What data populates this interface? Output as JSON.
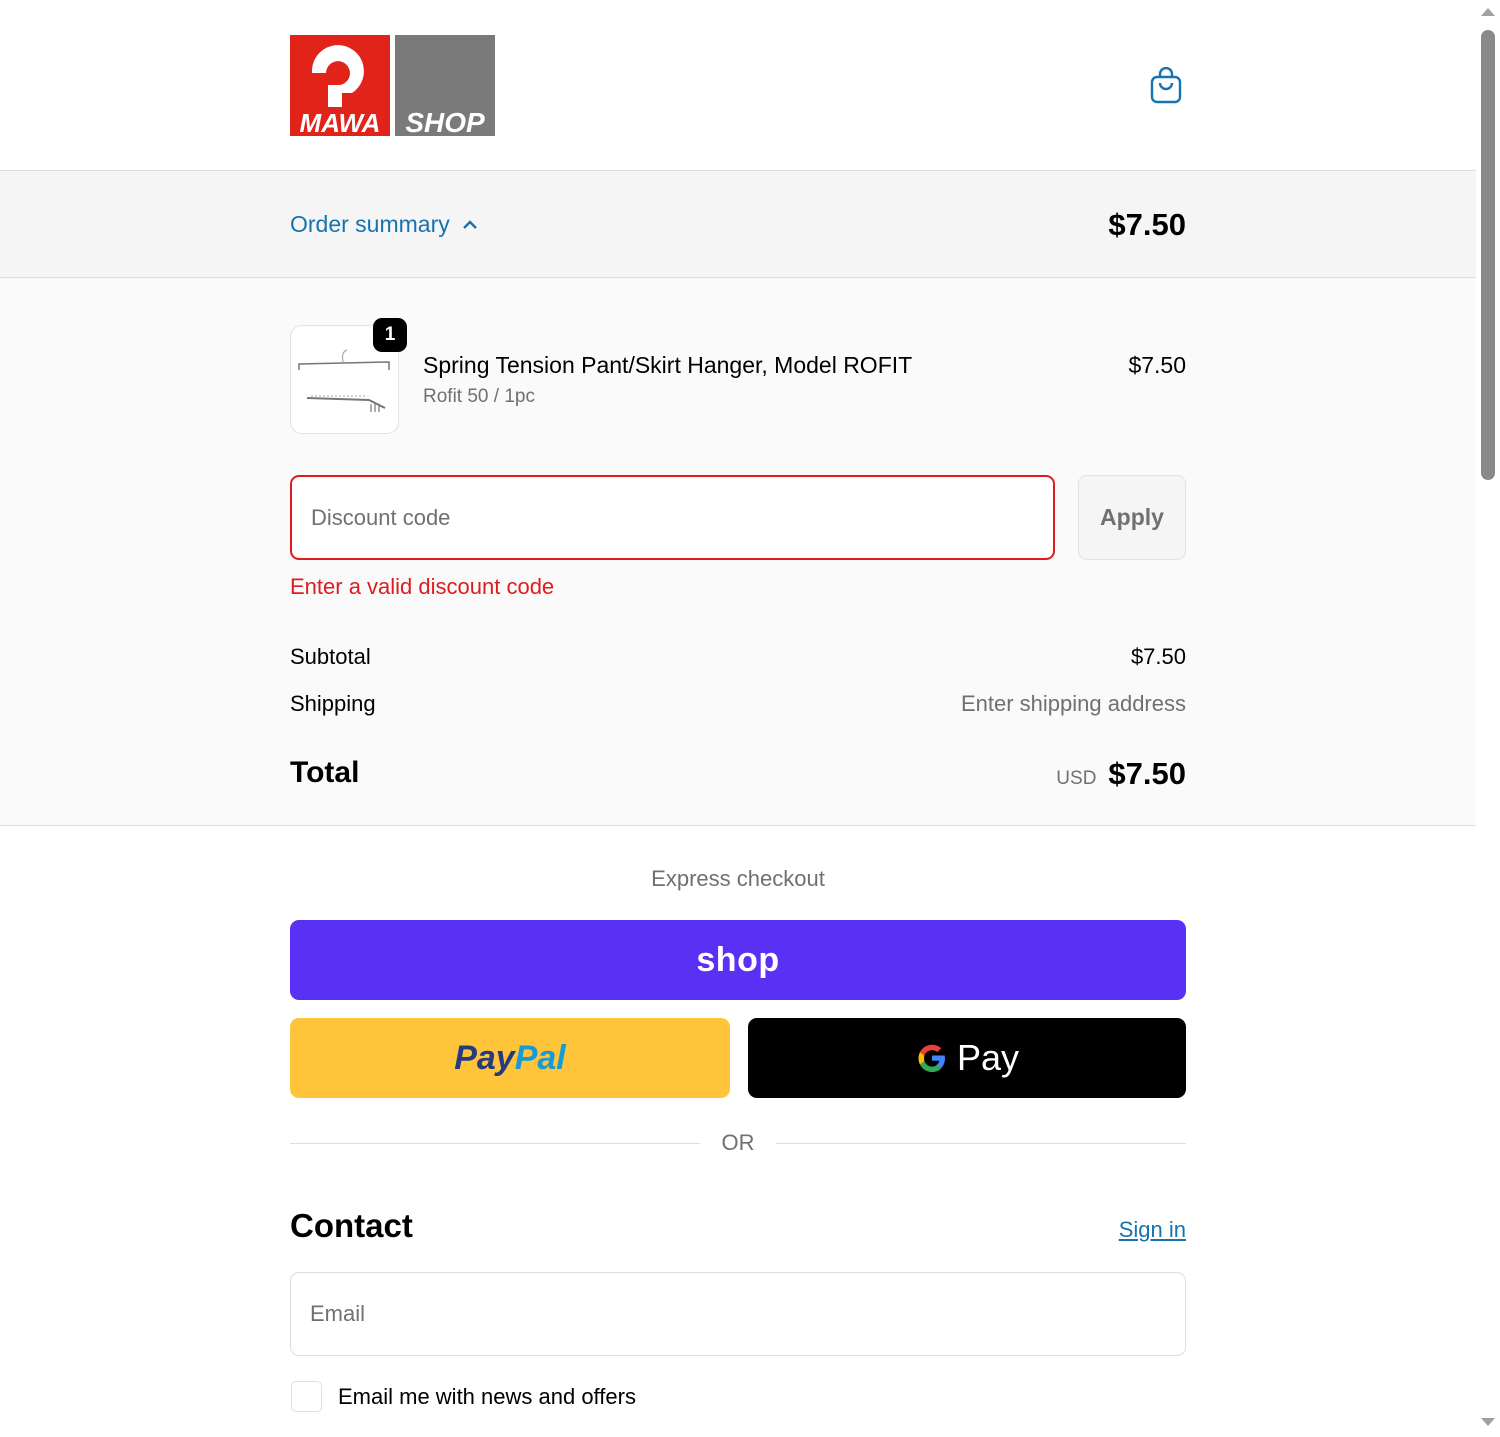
{
  "brand": {
    "logo_left": "MAWA",
    "logo_right": "SHOP",
    "logo_red": "#e2231a",
    "logo_gray": "#7a7a7a"
  },
  "header": {
    "cart_icon": "shopping-bag-icon"
  },
  "summary": {
    "toggle_label": "Order summary",
    "toggle_icon": "chevron-up-icon",
    "total": "$7.50"
  },
  "item": {
    "quantity": "1",
    "name": "Spring Tension Pant/Skirt Hanger, Model ROFIT",
    "variant": "Rofit 50 / 1pc",
    "price": "$7.50"
  },
  "discount": {
    "placeholder": "Discount code",
    "apply_label": "Apply",
    "error": "Enter a valid discount code"
  },
  "costs": {
    "subtotal_label": "Subtotal",
    "subtotal_value": "$7.50",
    "shipping_label": "Shipping",
    "shipping_value": "Enter shipping address",
    "total_label": "Total",
    "total_currency": "USD",
    "total_value": "$7.50"
  },
  "express": {
    "label": "Express checkout",
    "shop_label": "shop",
    "paypal_part1": "Pay",
    "paypal_part2": "Pal",
    "gpay_label": "Pay",
    "or_label": "OR"
  },
  "contact": {
    "title": "Contact",
    "signin_label": "Sign in",
    "email_placeholder": "Email",
    "newsletter_label": "Email me with news and offers"
  },
  "colors": {
    "accent": "#1773b0",
    "error": "#dd1d1d",
    "shop_pay": "#5a31f4",
    "paypal": "#ffc439",
    "gpay": "#000000"
  }
}
